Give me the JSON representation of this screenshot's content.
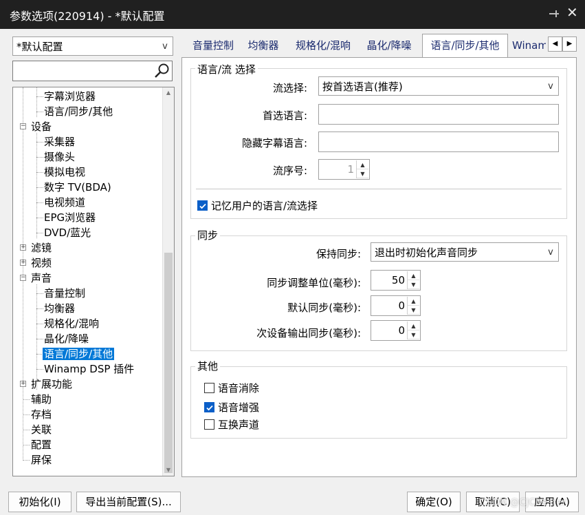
{
  "window": {
    "title": "参数选项(220914) - *默认配置"
  },
  "profile_select": {
    "value": "*默认配置"
  },
  "search": {
    "placeholder": ""
  },
  "tree": {
    "items": [
      {
        "label": "字幕浏览器"
      },
      {
        "label": "语言/同步/其他"
      },
      {
        "label": "设备"
      },
      {
        "label": "采集器"
      },
      {
        "label": "摄像头"
      },
      {
        "label": "模拟电视"
      },
      {
        "label": "数字 TV(BDA)"
      },
      {
        "label": "电视频道"
      },
      {
        "label": "EPG浏览器"
      },
      {
        "label": "DVD/蓝光"
      },
      {
        "label": "滤镜"
      },
      {
        "label": "视频"
      },
      {
        "label": "声音"
      },
      {
        "label": "音量控制"
      },
      {
        "label": "均衡器"
      },
      {
        "label": "规格化/混响"
      },
      {
        "label": "晶化/降噪"
      },
      {
        "label": "语言/同步/其他"
      },
      {
        "label": "Winamp DSP 插件"
      },
      {
        "label": "扩展功能"
      },
      {
        "label": "辅助"
      },
      {
        "label": "存档"
      },
      {
        "label": "关联"
      },
      {
        "label": "配置"
      },
      {
        "label": "屏保"
      }
    ]
  },
  "tabs": [
    {
      "label": "音量控制"
    },
    {
      "label": "均衡器"
    },
    {
      "label": "规格化/混响"
    },
    {
      "label": "晶化/降噪"
    },
    {
      "label": "语言/同步/其他"
    },
    {
      "label": "Winamp"
    }
  ],
  "lang_group": {
    "title": "语言/流 选择",
    "stream_select_label": "流选择:",
    "stream_select_value": "按首选语言(推荐)",
    "preferred_lang_label": "首选语言:",
    "preferred_lang_value": "",
    "hidden_sub_label": "隐藏字幕语言:",
    "hidden_sub_value": "",
    "stream_no_label": "流序号:",
    "stream_no_value": "1",
    "remember_label": "记忆用户的语言/流选择",
    "remember_checked": true
  },
  "sync_group": {
    "title": "同步",
    "keep_sync_label": "保持同步:",
    "keep_sync_value": "退出时初始化声音同步",
    "step_label": "同步调整单位(毫秒):",
    "step_value": "50",
    "default_label": "默认同步(毫秒):",
    "default_value": "0",
    "secondary_label": "次设备输出同步(毫秒):",
    "secondary_value": "0"
  },
  "other_group": {
    "title": "其他",
    "voice_cancel_label": "语音消除",
    "voice_cancel_checked": false,
    "voice_boost_label": "语音增强",
    "voice_boost_checked": true,
    "swap_label": "互换声道",
    "swap_checked": false
  },
  "buttons": {
    "init": "初始化(I)",
    "export": "导出当前配置(S)...",
    "ok": "确定(O)",
    "cancel": "取消(C)",
    "apply": "应用(A)"
  },
  "watermark": "CSDN @CJCbester"
}
